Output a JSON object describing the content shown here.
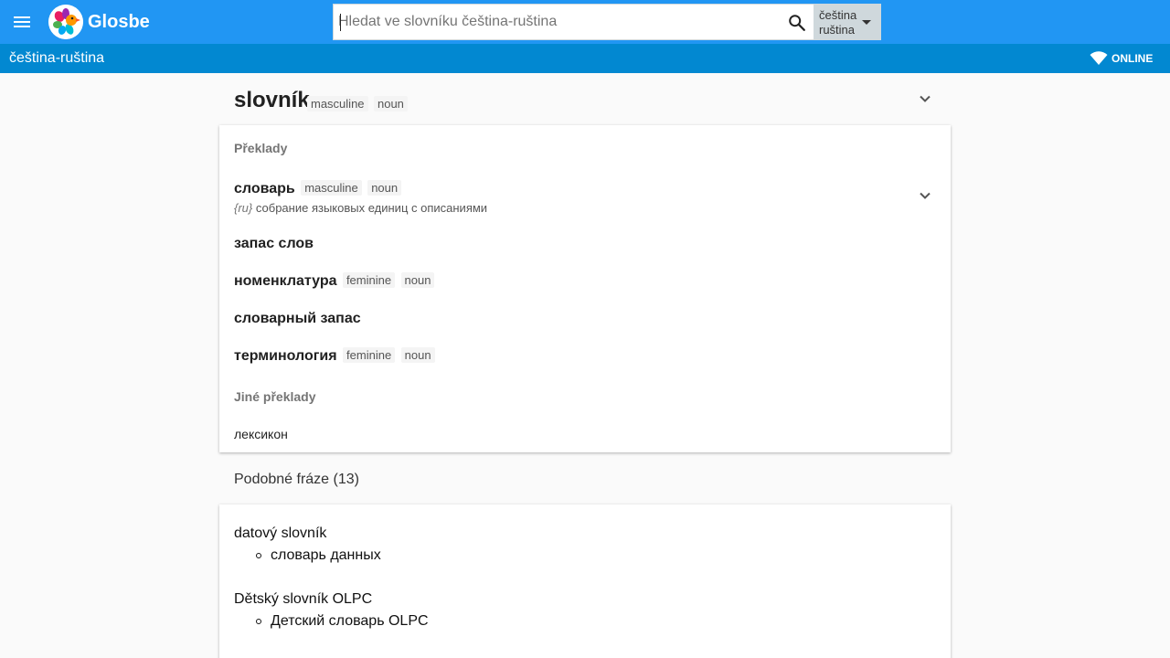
{
  "header": {
    "brand": "Glosbe",
    "search_placeholder": "Hledat ve slovníku čeština-ruština",
    "lang_from": "čeština",
    "lang_to": "ruština"
  },
  "subheader": {
    "pair_title": "čeština-ruština",
    "status": "ONLINE"
  },
  "entry": {
    "word": "slovník",
    "tags": [
      "masculine",
      "noun"
    ]
  },
  "translations": {
    "section_label": "Překlady",
    "items": [
      {
        "word": "словарь",
        "tags": [
          "masculine",
          "noun"
        ],
        "lang": "{ru}",
        "description": "собрание языковых единиц с описаниями"
      },
      {
        "word": "запас слов",
        "tags": []
      },
      {
        "word": "номенклатура",
        "tags": [
          "feminine",
          "noun"
        ]
      },
      {
        "word": "словарный запас",
        "tags": []
      },
      {
        "word": "терминология",
        "tags": [
          "feminine",
          "noun"
        ]
      }
    ],
    "other_label": "Jiné překlady",
    "other": [
      "лексикон"
    ]
  },
  "similar": {
    "title": "Podobné fráze (13)",
    "items": [
      {
        "phrase": "datový slovník",
        "translation": "словарь данных"
      },
      {
        "phrase": "Dětský slovník OLPC",
        "translation": "Детский словарь OLPC"
      }
    ]
  },
  "colors": {
    "topbar": "#2196f3",
    "subbar": "#0288d1",
    "background": "#fafafa"
  },
  "icons": [
    "menu-icon",
    "glosbe-logo-icon",
    "search-icon",
    "dropdown-arrow-icon",
    "wifi-icon",
    "chevron-down-icon"
  ]
}
